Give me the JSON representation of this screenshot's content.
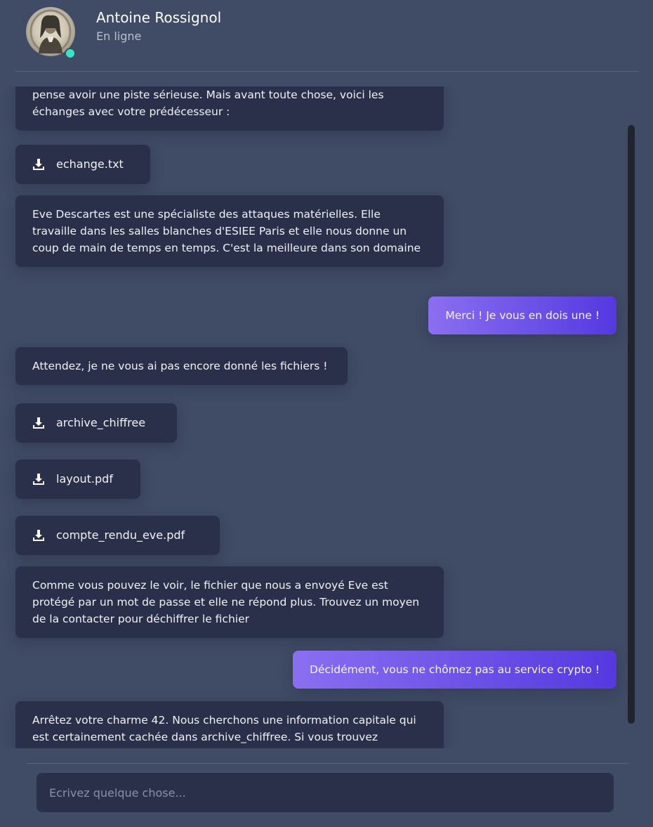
{
  "contact": {
    "name": "Antoine Rossignol",
    "status": "En ligne",
    "status_color": "#3be3c4"
  },
  "messages": [
    {
      "type": "text",
      "from": "contact",
      "text": "pense avoir une piste sérieuse. Mais avant toute chose, voici les échanges avec votre prédécesseur :"
    },
    {
      "type": "file",
      "from": "contact",
      "icon": "download-icon",
      "name": "echange.txt"
    },
    {
      "type": "text",
      "from": "contact",
      "text": "Eve Descartes est une spécialiste des attaques matérielles. Elle travaille dans les salles blanches d'ESIEE Paris et elle nous donne un coup de main de temps en temps. C'est la meilleure dans son domaine"
    },
    {
      "type": "text",
      "from": "me",
      "text": "Merci ! Je vous en dois une !"
    },
    {
      "type": "text",
      "from": "contact",
      "text": "Attendez, je ne vous ai pas encore donné les fichiers !"
    },
    {
      "type": "file",
      "from": "contact",
      "icon": "download-icon",
      "name": "archive_chiffree"
    },
    {
      "type": "file",
      "from": "contact",
      "icon": "download-icon",
      "name": "layout.pdf"
    },
    {
      "type": "file",
      "from": "contact",
      "icon": "download-icon",
      "name": "compte_rendu_eve.pdf"
    },
    {
      "type": "text",
      "from": "contact",
      "text": "Comme vous pouvez le voir, le fichier que nous a envoyé Eve est protégé par un mot de passe et elle ne répond plus. Trouvez un moyen de la contacter pour déchiffrer le fichier"
    },
    {
      "type": "text",
      "from": "me",
      "text": "Décidément, vous ne chômez pas au service crypto !"
    },
    {
      "type": "text",
      "from": "contact",
      "text": "Arrêtez votre charme 42. Nous cherchons une information capitale qui est certainement cachée dans archive_chiffree. Si vous trouvez"
    }
  ],
  "composer": {
    "placeholder": "Ecrivez quelque chose..."
  },
  "colors": {
    "background": "#404b66",
    "bubble_in": "#2b304a",
    "bubble_out_start": "#8a6ff1",
    "bubble_out_end": "#5539e0"
  }
}
